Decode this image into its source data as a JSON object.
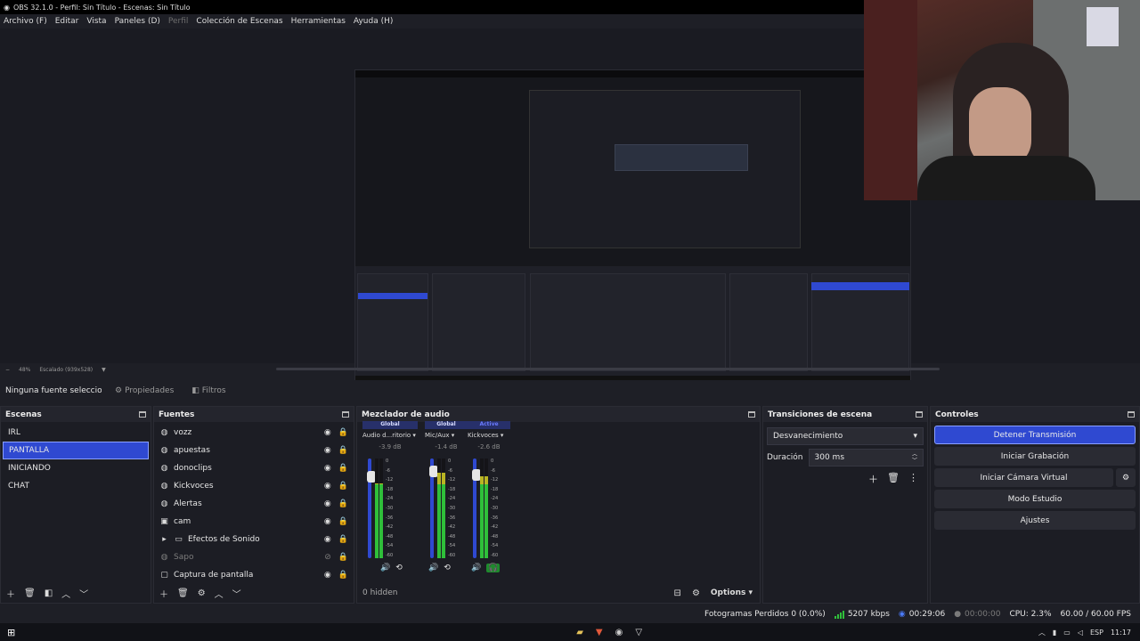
{
  "window": {
    "title": "OBS 32.1.0 - Perfil: Sin Título - Escenas: Sin Título"
  },
  "menu": [
    {
      "label": "Archivo (F)",
      "enabled": true
    },
    {
      "label": "Editar",
      "enabled": true
    },
    {
      "label": "Vista",
      "enabled": true
    },
    {
      "label": "Paneles (D)",
      "enabled": true
    },
    {
      "label": "Perfil",
      "enabled": false
    },
    {
      "label": "Colección de Escenas",
      "enabled": true
    },
    {
      "label": "Herramientas",
      "enabled": true
    },
    {
      "label": "Ayuda (H)",
      "enabled": true
    }
  ],
  "preview": {
    "zoom": "48%",
    "scaling": "Escalado (939x528)"
  },
  "properties_bar": {
    "no_source": "Ninguna fuente seleccionada",
    "properties_label": "Propiedades",
    "filters_label": "Filtros"
  },
  "scenes": {
    "title": "Escenas",
    "items": [
      {
        "label": "IRL",
        "selected": false
      },
      {
        "label": "PANTALLA",
        "selected": true
      },
      {
        "label": "INICIANDO",
        "selected": false
      },
      {
        "label": "CHAT",
        "selected": false
      }
    ]
  },
  "sources": {
    "title": "Fuentes",
    "items": [
      {
        "label": "vozz",
        "icon": "globe-icon",
        "visible": true
      },
      {
        "label": "apuestas",
        "icon": "globe-icon",
        "visible": true
      },
      {
        "label": "donoclips",
        "icon": "globe-icon",
        "visible": true
      },
      {
        "label": "Kickvoces",
        "icon": "globe-icon",
        "visible": true
      },
      {
        "label": "Alertas",
        "icon": "globe-icon",
        "visible": true
      },
      {
        "label": "cam",
        "icon": "camera-icon",
        "visible": true
      },
      {
        "label": "Efectos de Sonido",
        "icon": "folder-icon",
        "visible": true
      },
      {
        "label": "Sapo",
        "icon": "globe-icon",
        "visible": false
      },
      {
        "label": "Captura de pantalla",
        "icon": "monitor-icon",
        "visible": true
      }
    ]
  },
  "mixer": {
    "title": "Mezclador de audio",
    "hidden_count": "0 hidden",
    "options_label": "Options",
    "channels": [
      {
        "tag": "Global",
        "name": "Audio d...ritorio",
        "db": "-3.9 dB",
        "level": 0.75,
        "fader": 0.86
      },
      {
        "tag": "Global",
        "name": "Mic/Aux",
        "db": "-1.4 dB",
        "level": 0.86,
        "fader": 0.92
      },
      {
        "tag": "Active",
        "name": "Kickvoces",
        "db": "-2.6 dB",
        "level": 0.82,
        "fader": 0.88
      }
    ],
    "scale": [
      "0",
      "-6",
      "-12",
      "-18",
      "-24",
      "-30",
      "-36",
      "-42",
      "-48",
      "-54",
      "-60"
    ]
  },
  "transitions": {
    "title": "Transiciones de escena",
    "selected": "Desvanecimiento",
    "duration_label": "Duración",
    "duration_value": "300 ms"
  },
  "controls": {
    "title": "Controles",
    "stop_stream": "Detener Transmisión",
    "start_recording": "Iniciar Grabación",
    "start_virtual_cam": "Iniciar Cámara Virtual",
    "studio_mode": "Modo Estudio",
    "settings": "Ajustes"
  },
  "status": {
    "dropped_frames": "Fotogramas Perdidos 0 (0.0%)",
    "bitrate": "5207 kbps",
    "stream_time": "00:29:06",
    "record_time": "00:00:00",
    "cpu": "CPU: 2.3%",
    "fps": "60.00 / 60.00 FPS"
  },
  "taskbar": {
    "lang": "ESP",
    "time": "11:17"
  },
  "colors": {
    "accent": "#2f49d1",
    "meter_green": "#2fbf3a",
    "meter_yellow": "#b9b523",
    "meter_red": "#b0182f"
  }
}
